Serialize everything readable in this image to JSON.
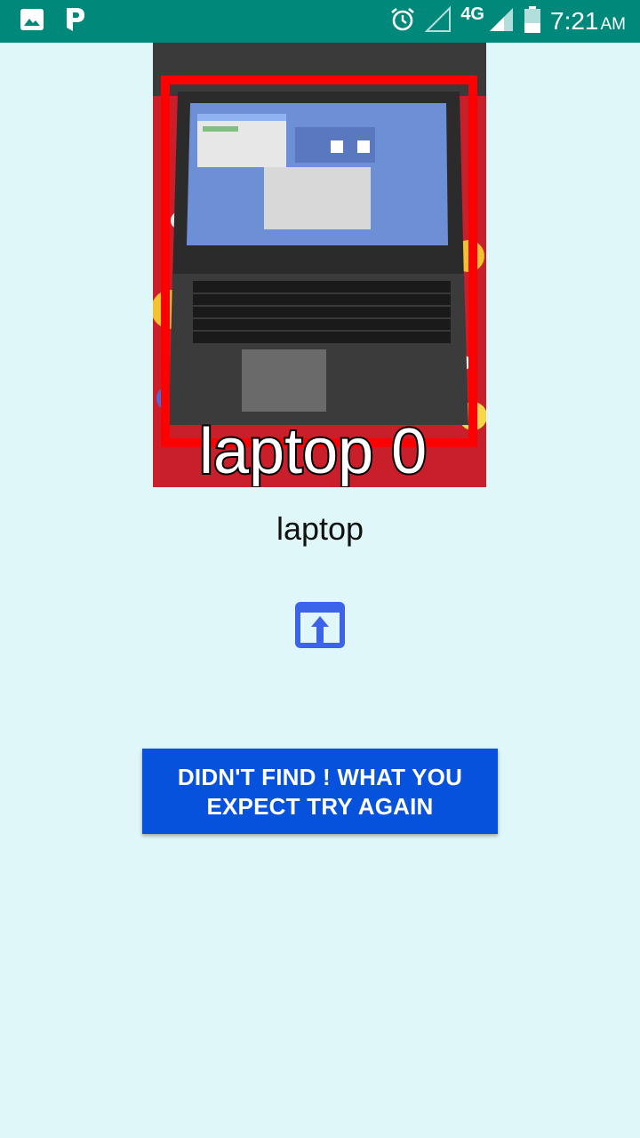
{
  "status_bar": {
    "time": "7:21",
    "ampm": "AM",
    "network": "4G",
    "left_icons": [
      "gallery-icon",
      "app-p-icon"
    ],
    "right_icons": [
      "alarm-icon",
      "signal-empty-icon",
      "signal-icon",
      "battery-icon"
    ],
    "background_color": "#00897b"
  },
  "detection": {
    "overlay_text": "laptop 0",
    "box_color": "#ff0000"
  },
  "result": {
    "label": "laptop"
  },
  "share": {
    "icon": "open-in-icon",
    "color": "#3d63e8"
  },
  "retry_button": {
    "label": "DIDN'T FIND ! WHAT YOU EXPECT TRY AGAIN",
    "color": "#0652dd"
  },
  "background_color": "#dff7f8"
}
